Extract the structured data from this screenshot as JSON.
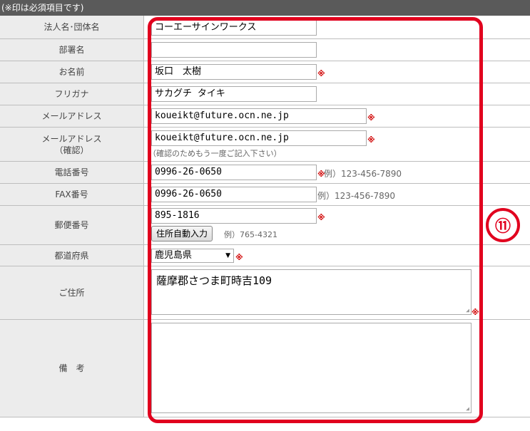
{
  "header_note": "(※印は必須項目です)",
  "required_mark": "※",
  "fields": {
    "company": {
      "label": "法人名･団体名",
      "value": "コーエーサインワークス"
    },
    "department": {
      "label": "部署名",
      "value": ""
    },
    "name": {
      "label": "お名前",
      "value": "坂口　太樹"
    },
    "furigana": {
      "label": "フリガナ",
      "value": "サカグチ タイキ"
    },
    "email": {
      "label": "メールアドレス",
      "value": "koueikt@future.ocn.ne.jp"
    },
    "email_confirm": {
      "label_line1": "メールアドレス",
      "label_line2": "（確認）",
      "value": "koueikt@future.ocn.ne.jp",
      "hint": "（確認のためもう一度ご記入下さい）"
    },
    "phone": {
      "label": "電話番号",
      "value": "0996-26-0650",
      "example": "例）123-456-7890"
    },
    "fax": {
      "label": "FAX番号",
      "value": "0996-26-0650",
      "example": "例）123-456-7890"
    },
    "postal": {
      "label": "郵便番号",
      "value": "895-1816",
      "button": "住所自動入力",
      "example": "例）765-4321"
    },
    "prefecture": {
      "label": "都道府県",
      "selected": "鹿児島県"
    },
    "address": {
      "label": "ご住所",
      "value": "薩摩郡さつま町時吉109"
    },
    "remarks": {
      "label": "備　考",
      "value": ""
    }
  },
  "annotation_marker": "⑪",
  "colors": {
    "highlight": "#e1001e",
    "required": "#d00000",
    "label_bg": "#ececec",
    "header_bg": "#5a5a5a"
  }
}
